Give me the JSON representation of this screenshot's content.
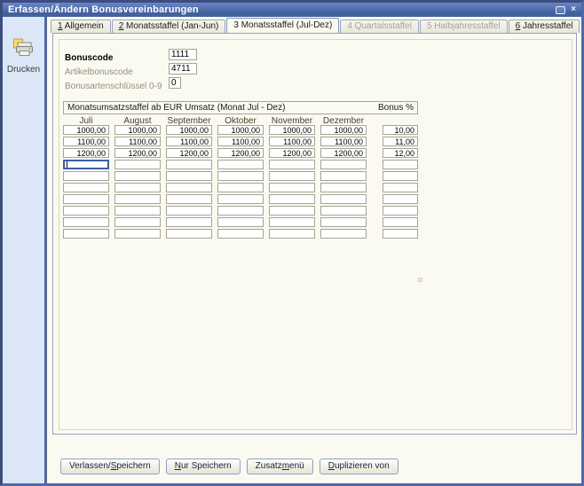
{
  "window": {
    "title": "Erfassen/Ändern Bonusvereinbarungen",
    "close_glyph": "×"
  },
  "sidebar": {
    "print_label": "Drucken"
  },
  "tabs": [
    {
      "label": "_1 Allgemein",
      "state": "normal"
    },
    {
      "label": "_2 Monatsstaffel (Jan-Jun)",
      "state": "normal"
    },
    {
      "label": "3 Monatsstaffel (Jul-Dez)",
      "state": "active"
    },
    {
      "label": "4 Quartalsstaffel",
      "state": "disabled"
    },
    {
      "label": "5 Halbjahresstaffel",
      "state": "disabled"
    },
    {
      "label": "_6 Jahresstaffel",
      "state": "normal"
    }
  ],
  "fields": [
    {
      "label": "Bonuscode",
      "value": "1111",
      "emphasis": true,
      "width": 32
    },
    {
      "label": "Artikelbonuscode",
      "value": "4711",
      "emphasis": false,
      "width": 32
    },
    {
      "label": "Bonusartenschlüssel 0-9",
      "value": "0",
      "emphasis": false,
      "width": 14
    }
  ],
  "grid": {
    "section_title": "Monatsumsatzstaffel ab EUR Umsatz (Monat Jul - Dez)",
    "bonus_title": "Bonus %",
    "columns": [
      "Juli",
      "August",
      "September",
      "Oktober",
      "November",
      "Dezember"
    ],
    "rows": [
      {
        "months": [
          "1000,00",
          "1000,00",
          "1000,00",
          "1000,00",
          "1000,00",
          "1000,00"
        ],
        "bonus": "10,00",
        "focused": false
      },
      {
        "months": [
          "1100,00",
          "1100,00",
          "1100,00",
          "1100,00",
          "1100,00",
          "1100,00"
        ],
        "bonus": "11,00",
        "focused": false
      },
      {
        "months": [
          "1200,00",
          "1200,00",
          "1200,00",
          "1200,00",
          "1200,00",
          "1200,00"
        ],
        "bonus": "12,00",
        "focused": false
      },
      {
        "months": [
          "",
          "",
          "",
          "",
          "",
          ""
        ],
        "bonus": "",
        "focused": true
      },
      {
        "months": [
          "",
          "",
          "",
          "",
          "",
          ""
        ],
        "bonus": "",
        "focused": false
      },
      {
        "months": [
          "",
          "",
          "",
          "",
          "",
          ""
        ],
        "bonus": "",
        "focused": false
      },
      {
        "months": [
          "",
          "",
          "",
          "",
          "",
          ""
        ],
        "bonus": "",
        "focused": false
      },
      {
        "months": [
          "",
          "",
          "",
          "",
          "",
          ""
        ],
        "bonus": "",
        "focused": false
      },
      {
        "months": [
          "",
          "",
          "",
          "",
          "",
          ""
        ],
        "bonus": "",
        "focused": false
      },
      {
        "months": [
          "",
          "",
          "",
          "",
          "",
          ""
        ],
        "bonus": "",
        "focused": false
      }
    ]
  },
  "buttons": [
    {
      "label": "Verlassen/_Speichern"
    },
    {
      "label": "_Nur Speichern"
    },
    {
      "label": "Zusatz_menü"
    },
    {
      "label": "_Duplizieren von"
    }
  ],
  "colors": {
    "titlebar_blue": "#44619f",
    "frame_blue": "#4d69ae",
    "sidebar_blue": "#dbe7f6",
    "content_cream": "#fbfaf0",
    "focus_border": "#3e5fa0"
  }
}
